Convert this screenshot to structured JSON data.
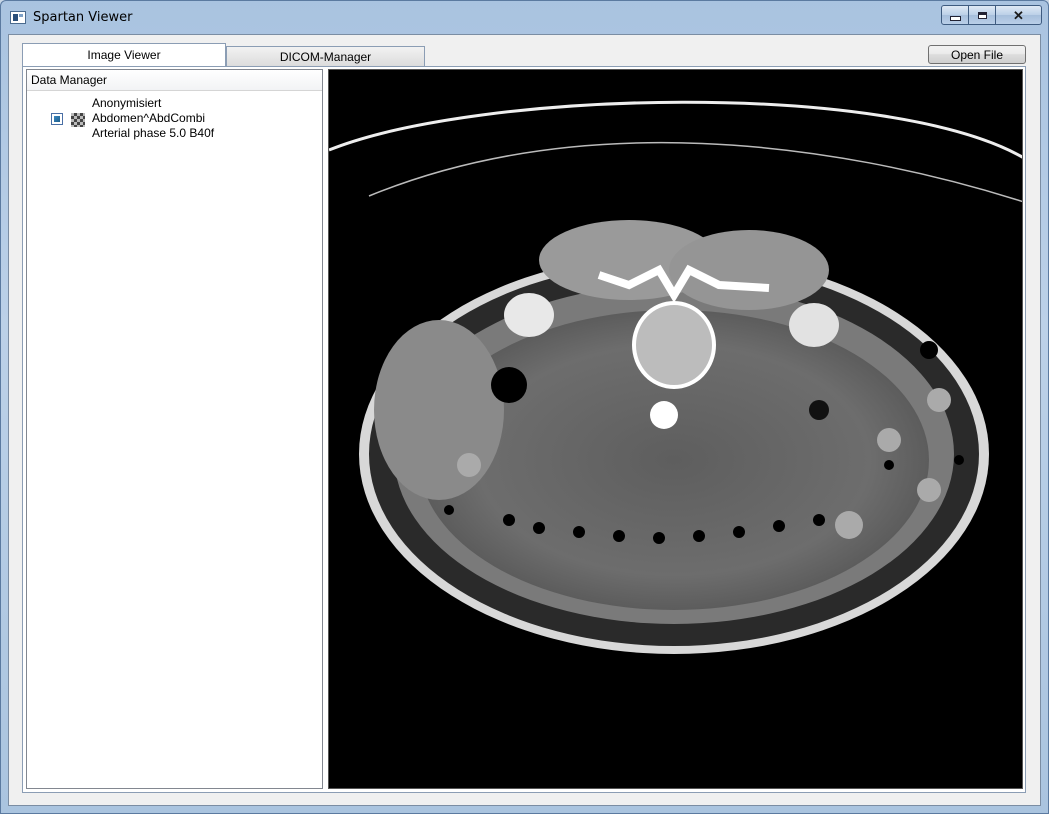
{
  "window": {
    "title": "Spartan Viewer",
    "close_glyph": "✕"
  },
  "tabs": [
    {
      "label": "Image Viewer",
      "active": true
    },
    {
      "label": "DICOM-Manager",
      "active": false
    }
  ],
  "toolbar": {
    "open_file_label": "Open File"
  },
  "data_manager": {
    "header": "Data Manager",
    "items": [
      {
        "lines": [
          "Anonymisiert",
          "Abdomen^AbdCombi",
          "Arterial phase 5.0 B40f"
        ],
        "checked": true,
        "icon": "image-thumbnail-icon"
      }
    ]
  },
  "viewer": {
    "content": "ct-axial-abdomen-slice",
    "background": "#000000"
  },
  "colors": {
    "frame": "#aac4df",
    "client_bg": "#f0f0f0",
    "checkbox_fill": "#2a73a8"
  }
}
